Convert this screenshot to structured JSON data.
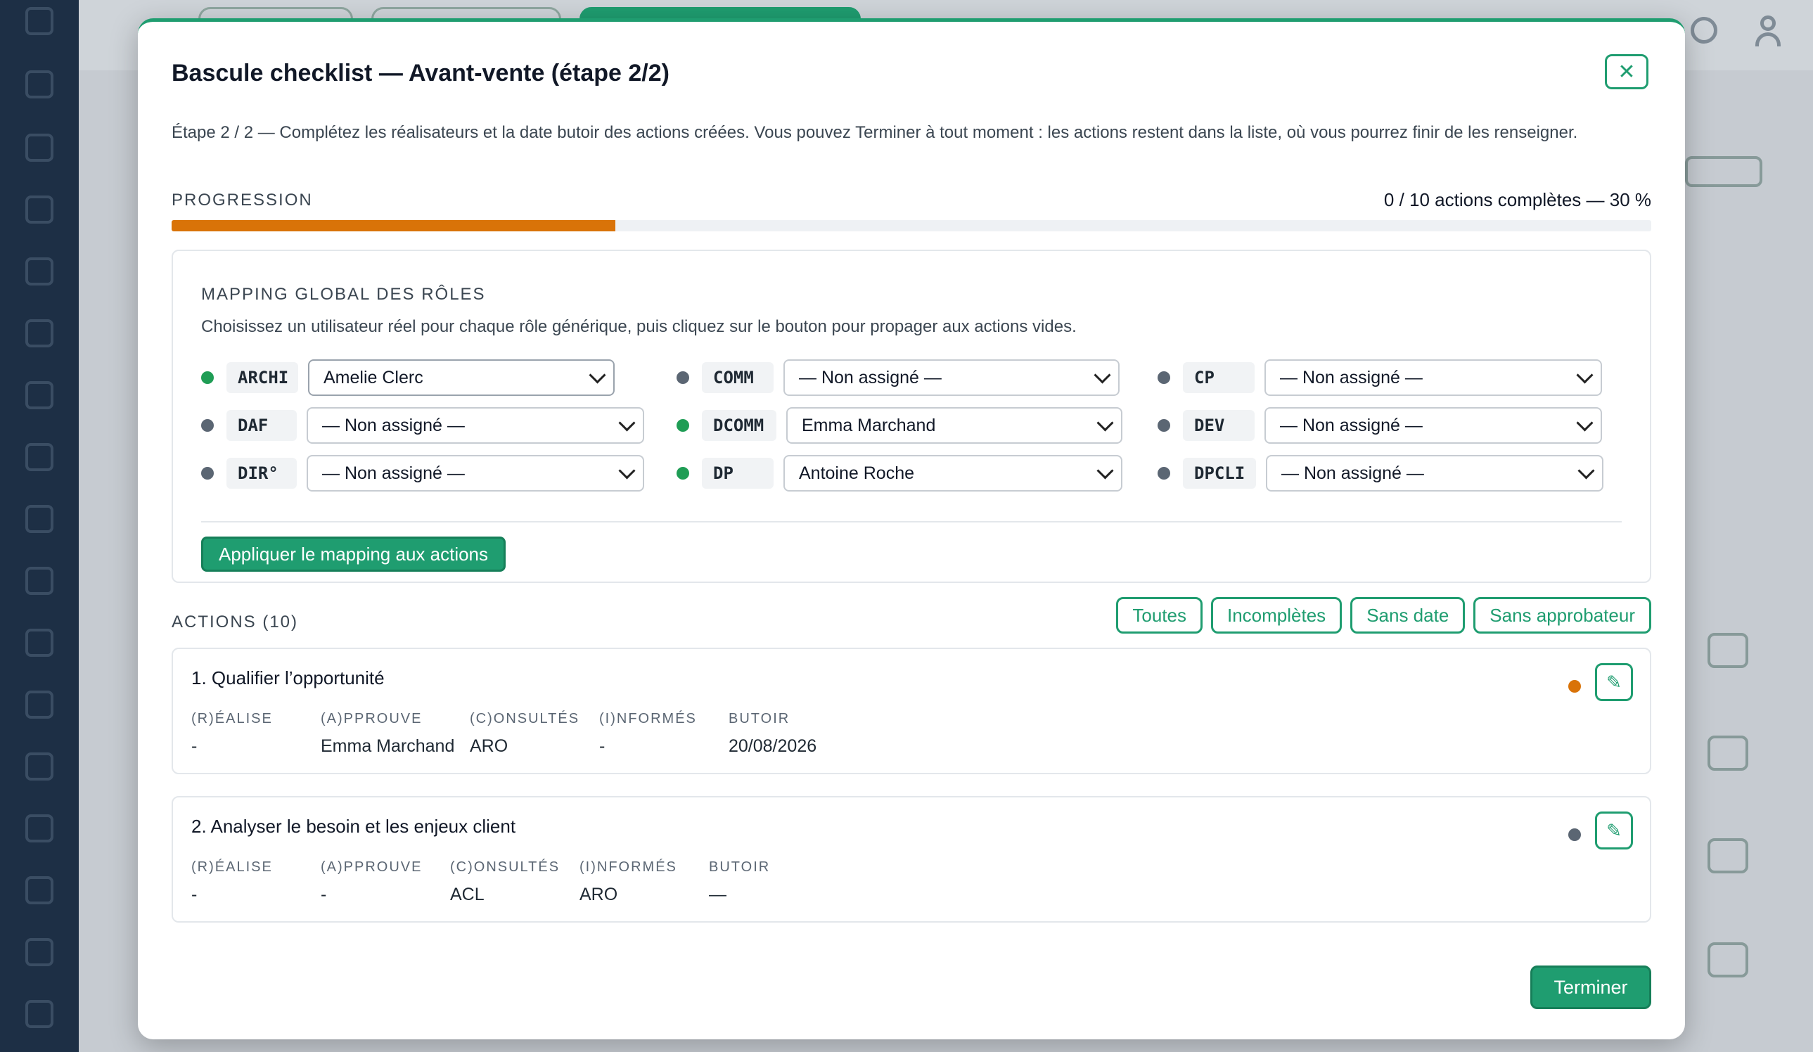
{
  "modal": {
    "title": "Bascule checklist — Avant-vente (étape 2/2)",
    "close_icon": "close-icon",
    "intro": "Étape 2 / 2 — Complétez les réalisateurs et la date butoir des actions créées. Vous pouvez Terminer à tout moment : les actions restent dans la liste, où vous pourrez finir de les renseigner."
  },
  "progress": {
    "label": "PROGRESSION",
    "count_text": "0 / 10 actions complètes — 30 %",
    "percent": 30,
    "color": "#d97308"
  },
  "mapping": {
    "title": "MAPPING GLOBAL DES RÔLES",
    "description": "Choisissez un utilisateur réel pour chaque rôle générique, puis cliquez sur le bouton pour propager aux actions vides.",
    "roles": [
      {
        "code": "ARCHI",
        "value": "Amelie Clerc",
        "assigned": true
      },
      {
        "code": "COMM",
        "value": "— Non assigné —",
        "assigned": false
      },
      {
        "code": "CP",
        "value": "— Non assigné —",
        "assigned": false
      },
      {
        "code": "DAF",
        "value": "— Non assigné —",
        "assigned": false
      },
      {
        "code": "DCOMM",
        "value": "Emma Marchand",
        "assigned": true
      },
      {
        "code": "DEV",
        "value": "— Non assigné —",
        "assigned": false
      },
      {
        "code": "DIR°",
        "value": "— Non assigné —",
        "assigned": false
      },
      {
        "code": "DP",
        "value": "Antoine Roche",
        "assigned": true
      },
      {
        "code": "DPCLI",
        "value": "— Non assigné —",
        "assigned": false
      }
    ],
    "apply_label": "Appliquer le mapping aux actions"
  },
  "actions": {
    "label": "ACTIONS (10)",
    "filters": [
      "Toutes",
      "Incomplètes",
      "Sans date",
      "Sans approbateur"
    ],
    "columns": [
      "(R)ÉALISE",
      "(A)PPROUVE",
      "(C)ONSULTÉS",
      "(I)NFORMÉS",
      "BUTOIR"
    ],
    "items": [
      {
        "title": "1. Qualifier l’opportunité",
        "status": "orange",
        "values": [
          "-",
          "Emma Marchand",
          "ARO",
          "-",
          "20/08/2026"
        ]
      },
      {
        "title": "2. Analyser le besoin et les enjeux client",
        "status": "grey",
        "values": [
          "-",
          "-",
          "ACL",
          "ARO",
          "—"
        ]
      }
    ],
    "edit_icon": "pencil-icon"
  },
  "footer": {
    "finish_label": "Terminer"
  },
  "colors": {
    "accent": "#1f9d70",
    "assigned": "#1f9d55",
    "unassigned": "#5b6673",
    "warning": "#d97308"
  }
}
